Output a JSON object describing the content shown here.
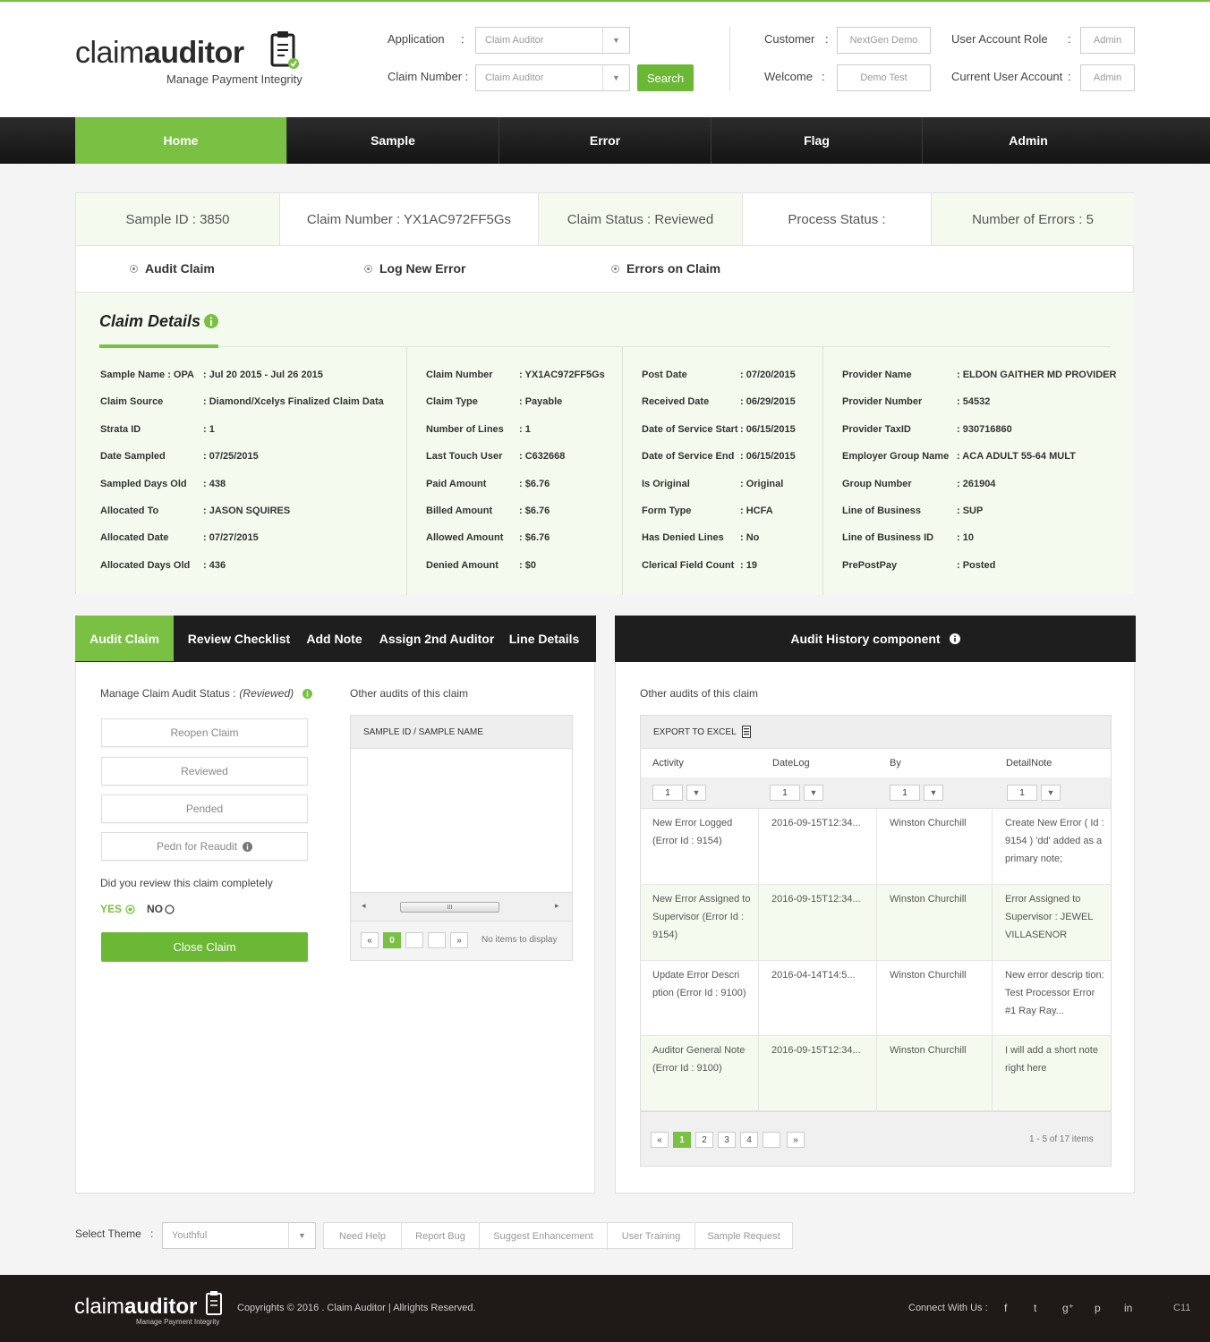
{
  "header": {
    "logo_light": "claim",
    "logo_bold": "auditor",
    "tagline": "Manage Payment Integrity",
    "application_label": "Application",
    "application_value": "Claim Auditor",
    "claim_number_label": "Claim Number :",
    "claim_number_value": "Claim Auditor",
    "search_label": "Search",
    "customer_label": "Customer",
    "customer_value": "NextGen Demo",
    "welcome_label": "Welcome",
    "welcome_value": "Demo Test",
    "role_label": "User Account Role",
    "role_value": "Admin",
    "current_user_label": "Current User Account",
    "current_user_value": "Admin",
    "colon": ":"
  },
  "nav": [
    "Home",
    "Sample",
    "Error",
    "Flag",
    "Admin"
  ],
  "status_bar": {
    "sample_id": "Sample ID : 3850",
    "claim_number": "Claim Number : YX1AC972FF5Gs",
    "claim_status": "Claim Status : Reviewed",
    "process_status": "Process Status :",
    "errors": "Number of Errors : 5"
  },
  "mode_options": [
    "Audit Claim",
    "Log New Error",
    "Errors on Claim"
  ],
  "claim_details": {
    "title": "Claim Details :",
    "col1": [
      {
        "label": "Sample Name : OPA",
        "value": ": Jul 20 2015 - Jul 26 2015"
      },
      {
        "label": "Claim Source",
        "value": ": Diamond/Xcelys Finalized Claim Data"
      },
      {
        "label": "Strata ID",
        "value": ": 1"
      },
      {
        "label": "Date Sampled",
        "value": ": 07/25/2015"
      },
      {
        "label": "Sampled Days Old",
        "value": ": 438"
      },
      {
        "label": "Allocated To",
        "value": ": JASON SQUIRES"
      },
      {
        "label": "Allocated Date",
        "value": ": 07/27/2015"
      },
      {
        "label": "Allocated Days Old",
        "value": ": 436"
      }
    ],
    "col2": [
      {
        "label": "Claim Number",
        "value": ": YX1AC972FF5Gs"
      },
      {
        "label": "Claim Type",
        "value": ": Payable"
      },
      {
        "label": "Number of Lines",
        "value": ": 1"
      },
      {
        "label": "Last Touch User",
        "value": ": C632668"
      },
      {
        "label": "Paid Amount",
        "value": ": $6.76"
      },
      {
        "label": "Billed Amount",
        "value": ": $6.76"
      },
      {
        "label": "Allowed Amount",
        "value": ": $6.76"
      },
      {
        "label": "Denied Amount",
        "value": ": $0"
      }
    ],
    "col3": [
      {
        "label": "Post Date",
        "value": ": 07/20/2015"
      },
      {
        "label": "Received Date",
        "value": ": 06/29/2015"
      },
      {
        "label": "Date of Service Start",
        "value": ": 06/15/2015"
      },
      {
        "label": "Date of Service End",
        "value": ": 06/15/2015"
      },
      {
        "label": "Is Original",
        "value": ": Original"
      },
      {
        "label": "Form Type",
        "value": ": HCFA"
      },
      {
        "label": "Has Denied Lines",
        "value": ": No"
      },
      {
        "label": "Clerical Field Count",
        "value": ": 19"
      }
    ],
    "col4": [
      {
        "label": "Provider Name",
        "value": ": ELDON GAITHER MD PROVIDER"
      },
      {
        "label": "Provider Number",
        "value": ": 54532"
      },
      {
        "label": "Provider TaxID",
        "value": ": 930716860"
      },
      {
        "label": "Employer Group Name",
        "value": ": ACA ADULT 55-64 MULT"
      },
      {
        "label": "Group Number",
        "value": ": 261904"
      },
      {
        "label": "Line of Business",
        "value": ": SUP"
      },
      {
        "label": "Line of Business ID",
        "value": ": 10"
      },
      {
        "label": "PrePostPay",
        "value": ": Posted"
      }
    ]
  },
  "left_panel": {
    "tabs": [
      "Audit Claim",
      "Review Checklist",
      "Add Note",
      "Assign 2nd Auditor",
      "Line Details"
    ],
    "manage_label": "Manage Claim Audit Status :",
    "manage_status": "(Reviewed)",
    "status_buttons": [
      "Reopen Claim",
      "Reviewed",
      "Pended",
      "Pedn for Reaudit"
    ],
    "question": "Did you review this claim completely",
    "yes": "YES",
    "no": "NO",
    "close_button": "Close Claim",
    "other_audits_label": "Other audits of this claim",
    "grid_header": "SAMPLE ID / SAMPLE NAME",
    "scroll_thumb": "III",
    "page_first": "«",
    "page_current": "0",
    "page_last": "»",
    "no_items": "No items to display",
    "scroll_left": "◂",
    "scroll_right": "▸"
  },
  "right_panel": {
    "title": "Audit History component",
    "other_audits_label": "Other audits of this claim",
    "export_label": "EXPORT TO EXCEL",
    "columns": [
      "Activity",
      "DateLog",
      "By",
      "DetailNote"
    ],
    "filter_value": "1",
    "rows": [
      {
        "activity": "New Error Logged (Error Id : 9154)",
        "date": "2016-09-15T12:34...",
        "by": "Winston Churchill",
        "note": "Create New Error ( Id : 9154 ) 'dd' added as a primary note;"
      },
      {
        "activity": "New Error Assigned to Supervisor (Error Id : 9154)",
        "date": "2016-09-15T12:34...",
        "by": "Winston Churchill",
        "note": "Error Assigned to Supervisor : JEWEL VILLASENOR"
      },
      {
        "activity": "Update Error Descri ption (Error Id : 9100)",
        "date": "2016-04-14T14:5...",
        "by": "Winston Churchill",
        "note": "New error descrip tion: Test Processor Error #1 Ray Ray..."
      },
      {
        "activity": "Auditor General Note (Error Id : 9100)",
        "date": "2016-09-15T12:34...",
        "by": "Winston Churchill",
        "note": "I will add a short note right here"
      }
    ],
    "pages": [
      "«",
      "1",
      "2",
      "3",
      "4",
      "",
      "»"
    ],
    "items_count": "1 - 5 of 17 items"
  },
  "bottom_bar": {
    "theme_label": "Select Theme",
    "colon": ":",
    "theme_value": "Youthful",
    "links": [
      "Need  Help",
      "Report Bug",
      "Suggest Enhancement",
      "User Training",
      "Sample Request"
    ]
  },
  "footer": {
    "logo_light": "claim",
    "logo_bold": "auditor",
    "tagline": "Manage Payment Integrity",
    "copyright": "Copyrights © 2016 . Claim Auditor | Allrights Reserved.",
    "connect": "Connect With Us :",
    "social": [
      "f",
      "t",
      "g⁺",
      "p",
      "in"
    ],
    "code": "C11"
  },
  "colors": {
    "accent": "#7ac143",
    "nav_dark": "#1e1e1e",
    "tint": "#f4fbee"
  }
}
